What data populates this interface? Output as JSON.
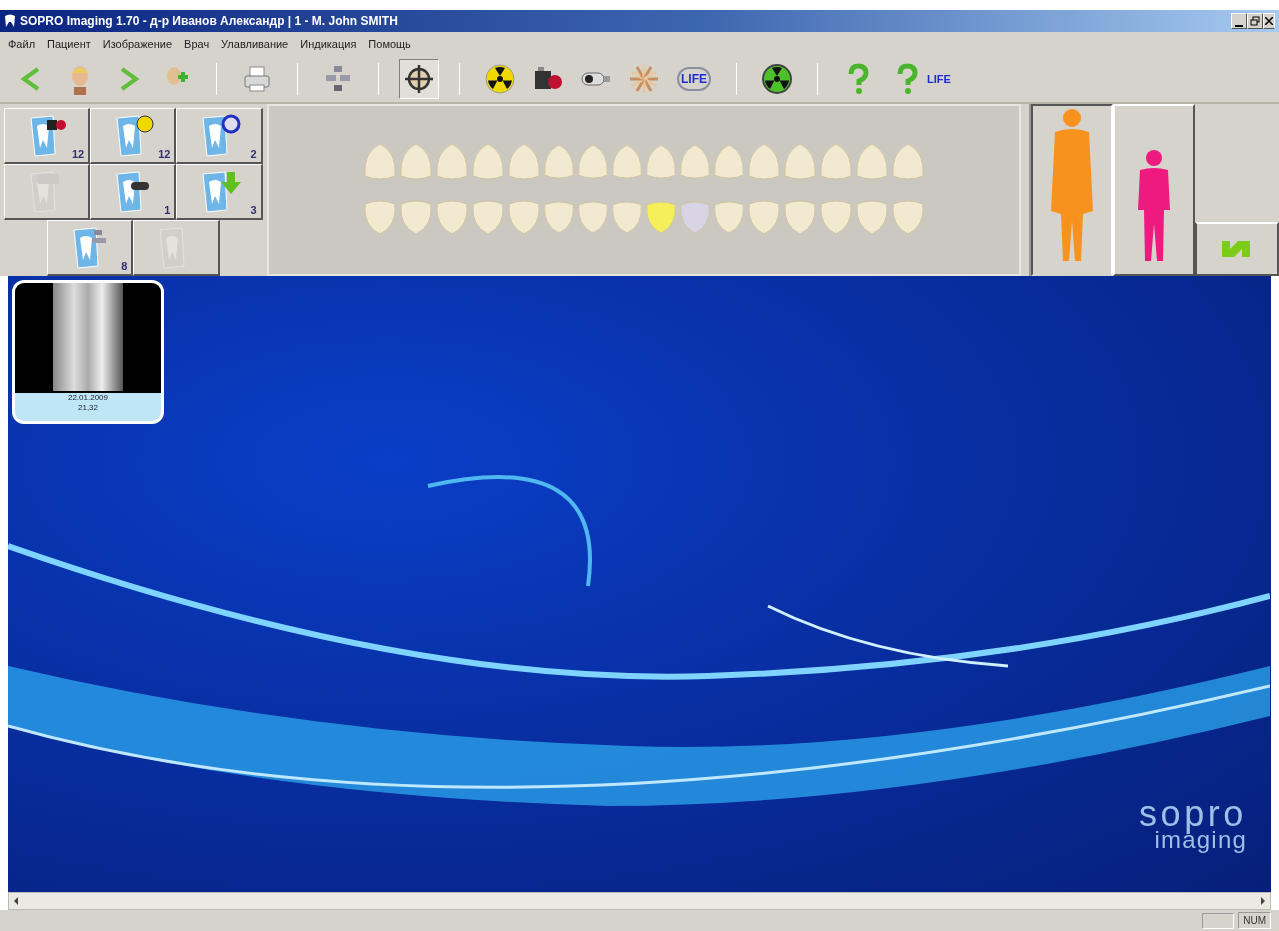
{
  "window": {
    "title": "SOPRO Imaging 1.70 - д-р Иванов Александр | 1 - M. John SMITH"
  },
  "menu": [
    "Файл",
    "Пациент",
    "Изображение",
    "Врач",
    "Улавливание",
    "Индикация",
    "Помощь"
  ],
  "toolbar": [
    {
      "kind": "back",
      "selected": false
    },
    {
      "kind": "patient",
      "selected": false
    },
    {
      "kind": "forward",
      "selected": false
    },
    {
      "kind": "add-patient",
      "selected": false
    },
    {
      "kind": "separator"
    },
    {
      "kind": "print",
      "selected": false
    },
    {
      "kind": "separator"
    },
    {
      "kind": "layout",
      "selected": false
    },
    {
      "kind": "separator"
    },
    {
      "kind": "target",
      "selected": true
    },
    {
      "kind": "separator"
    },
    {
      "kind": "radiation",
      "selected": false
    },
    {
      "kind": "camera",
      "selected": false
    },
    {
      "kind": "intraoral",
      "selected": false
    },
    {
      "kind": "fan",
      "selected": false
    },
    {
      "kind": "life",
      "label": "LIFE",
      "selected": false
    },
    {
      "kind": "separator"
    },
    {
      "kind": "radiation-green",
      "selected": false
    },
    {
      "kind": "separator"
    },
    {
      "kind": "help",
      "selected": false
    },
    {
      "kind": "help-life",
      "label": "LIFE",
      "selected": false
    }
  ],
  "tiles": [
    {
      "kind": "camera",
      "count": "12",
      "disabled": false
    },
    {
      "kind": "radiation",
      "count": "12",
      "disabled": false
    },
    {
      "kind": "life",
      "count": "2",
      "disabled": false
    },
    {
      "kind": "scanner",
      "disabled": true
    },
    {
      "kind": "intraoral",
      "count": "1",
      "disabled": false
    },
    {
      "kind": "import",
      "count": "3",
      "disabled": false
    },
    {
      "kind": "layout",
      "count": "8",
      "disabled": false
    },
    {
      "kind": "blank",
      "disabled": true
    }
  ],
  "teeth": {
    "upper": [
      {
        "color": "#f2ead0"
      },
      {
        "color": "#f2ead0"
      },
      {
        "color": "#f2ead0"
      },
      {
        "color": "#f2ead0"
      },
      {
        "color": "#f2ead0"
      },
      {
        "color": "#f2ead0"
      },
      {
        "color": "#f2ead0"
      },
      {
        "color": "#f2ead0"
      },
      {
        "color": "#f2ead0"
      },
      {
        "color": "#f2ead0"
      },
      {
        "color": "#f2ead0"
      },
      {
        "color": "#f2ead0"
      },
      {
        "color": "#f2ead0"
      },
      {
        "color": "#f2ead0"
      },
      {
        "color": "#f2ead0"
      },
      {
        "color": "#f2ead0"
      }
    ],
    "lower": [
      {
        "color": "#f2ead0"
      },
      {
        "color": "#f2ead0"
      },
      {
        "color": "#f2ead0"
      },
      {
        "color": "#f2ead0"
      },
      {
        "color": "#f2ead0"
      },
      {
        "color": "#f2ead0"
      },
      {
        "color": "#f2ead0"
      },
      {
        "color": "#f2ead0"
      },
      {
        "color": "#f5ef5c"
      },
      {
        "color": "#d9d3e6"
      },
      {
        "color": "#f2ead0"
      },
      {
        "color": "#f2ead0"
      },
      {
        "color": "#f2ead0"
      },
      {
        "color": "#f2ead0"
      },
      {
        "color": "#f2ead0"
      },
      {
        "color": "#f2ead0"
      }
    ]
  },
  "patient_types": [
    {
      "kind": "adult",
      "selected": true
    },
    {
      "kind": "child",
      "selected": false
    }
  ],
  "images": [
    {
      "date": "22.01.2009",
      "teeth": "21,32",
      "selected": true
    }
  ],
  "logo": {
    "name": "sopro",
    "subtitle": "imaging"
  },
  "status_bar": {
    "indicator": "NUM"
  }
}
